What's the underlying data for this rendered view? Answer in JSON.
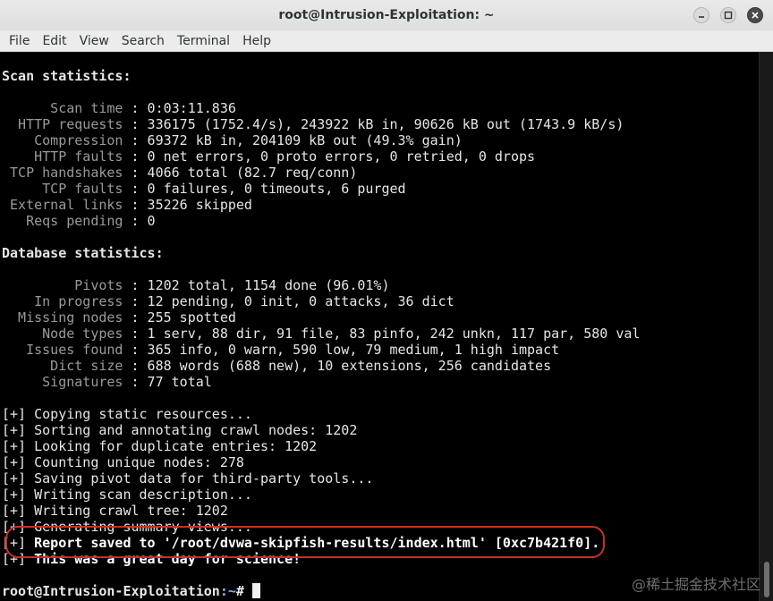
{
  "window": {
    "title": "root@Intrusion-Exploitation: ~"
  },
  "menu": [
    "File",
    "Edit",
    "View",
    "Search",
    "Terminal",
    "Help"
  ],
  "scan_heading": "Scan statistics:",
  "scan_stats": [
    {
      "label": "      Scan time",
      "value": " : 0:03:11.836"
    },
    {
      "label": "  HTTP requests",
      "value": " : 336175 (1752.4/s), 243922 kB in, 90626 kB out (1743.9 kB/s)"
    },
    {
      "label": "    Compression",
      "value": " : 69372 kB in, 204109 kB out (49.3% gain)"
    },
    {
      "label": "    HTTP faults",
      "value": " : 0 net errors, 0 proto errors, 0 retried, 0 drops"
    },
    {
      "label": " TCP handshakes",
      "value": " : 4066 total (82.7 req/conn)"
    },
    {
      "label": "     TCP faults",
      "value": " : 0 failures, 0 timeouts, 6 purged"
    },
    {
      "label": " External links",
      "value": " : 35226 skipped"
    },
    {
      "label": "   Reqs pending",
      "value": " : 0"
    }
  ],
  "db_heading": "Database statistics:",
  "db_stats": [
    {
      "label": "         Pivots",
      "value": " : 1202 total, 1154 done (96.01%)"
    },
    {
      "label": "    In progress",
      "value": " : 12 pending, 0 init, 0 attacks, 36 dict"
    },
    {
      "label": "  Missing nodes",
      "value": " : 255 spotted"
    },
    {
      "label": "     Node types",
      "value": " : 1 serv, 88 dir, 91 file, 83 pinfo, 242 unkn, 117 par, 580 val"
    },
    {
      "label": "   Issues found",
      "value": " : 365 info, 0 warn, 590 low, 79 medium, 1 high impact"
    },
    {
      "label": "      Dict size",
      "value": " : 688 words (688 new), 10 extensions, 256 candidates"
    },
    {
      "label": "     Signatures",
      "value": " : 77 total"
    }
  ],
  "progress_lines": [
    "[+] Copying static resources...",
    "[+] Sorting and annotating crawl nodes: 1202",
    "[+] Looking for duplicate entries: 1202",
    "[+] Counting unique nodes: 278",
    "[+] Saving pivot data for third-party tools...",
    "[+] Writing scan description...",
    "[+] Writing crawl tree: 1202",
    "[+] Generating summary views..."
  ],
  "report_line_prefix": "[+] ",
  "report_line": "Report saved to '/root/dvwa-skipfish-results/index.html' [0xc7b421f0].",
  "final_prefix": "[+] ",
  "final_line": "This was a great day for science!",
  "prompt": {
    "user_host": "root@Intrusion-Exploitation",
    "path": ":~",
    "symbol": "# "
  },
  "watermark": "@稀土掘金技术社区"
}
